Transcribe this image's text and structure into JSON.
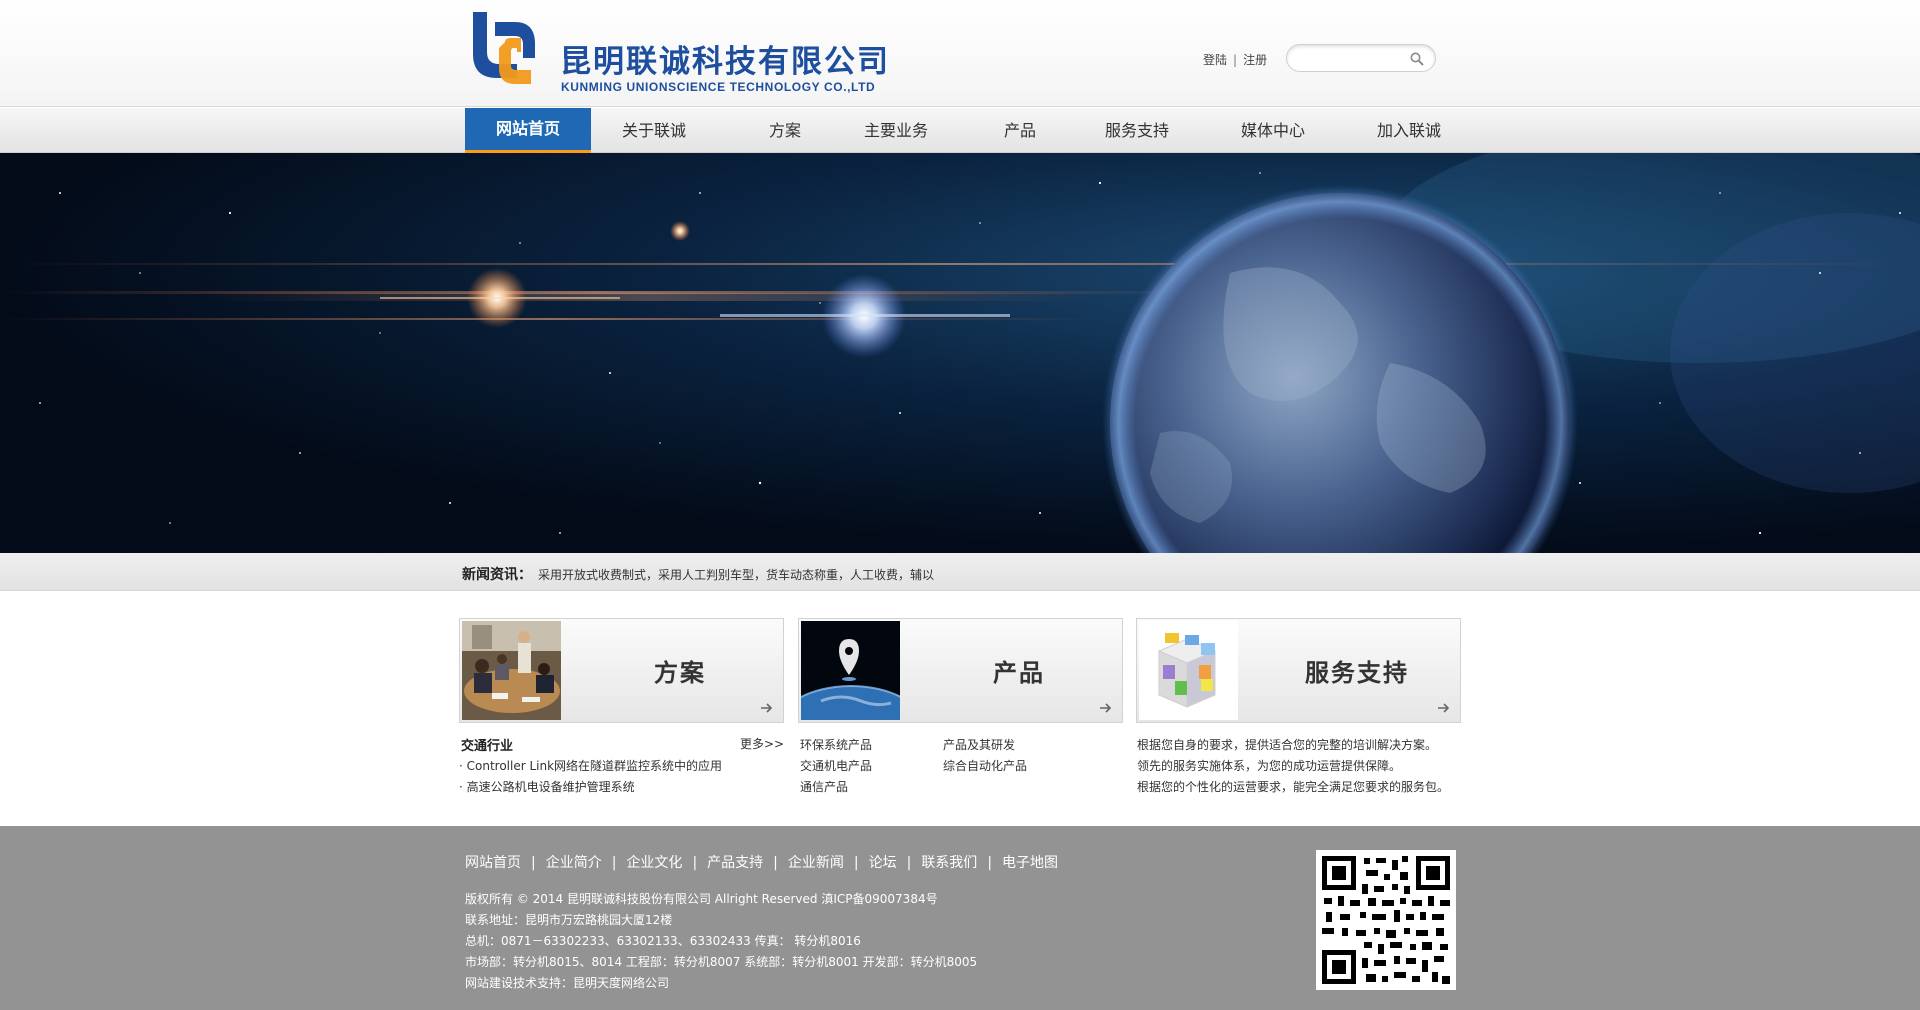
{
  "header": {
    "logo_cn": "昆明联诚科技有限公司",
    "logo_en": "KUNMING UNIONSCIENCE TECHNOLOGY CO.,LTD",
    "login": "登陆",
    "register": "注册",
    "search_placeholder": "",
    "search_icon": "magnifier-icon"
  },
  "nav": {
    "items": [
      "网站首页",
      "关于联诚",
      "方案",
      "主要业务",
      "产品",
      "服务支持",
      "媒体中心",
      "加入联诚"
    ],
    "active_index": 0
  },
  "news": {
    "label": "新闻资讯：",
    "text": "采用开放式收费制式，采用人工判别车型，货车动态称重，人工收费，辅以"
  },
  "cards": [
    {
      "title": "方案",
      "icon": "arrow-right-icon"
    },
    {
      "title": "产品",
      "icon": "arrow-right-icon"
    },
    {
      "title": "服务支持",
      "icon": "arrow-right-icon"
    }
  ],
  "solutions": {
    "heading": "交通行业",
    "more": "更多>>",
    "items": [
      "· Controller Link网络在隧道群监控系统中的应用",
      "· 高速公路机电设备维护管理系统"
    ]
  },
  "products": {
    "items": [
      "环保系统产品",
      "产品及其研发",
      "交通机电产品",
      "综合自动化产品",
      "通信产品"
    ]
  },
  "service": {
    "lines": [
      "根据您自身的要求，提供适合您的完整的培训解决方案。",
      "领先的服务实施体系，为您的成功运营提供保障。",
      "根据您的个性化的运营要求，能完全满足您要求的服务包。"
    ]
  },
  "footer": {
    "links": [
      "网站首页",
      "企业简介",
      "企业文化",
      "产品支持",
      "企业新闻",
      "论坛",
      "联系我们",
      "电子地图"
    ],
    "copyright": "版权所有 © 2014 昆明联诚科技股份有限公司 Allright Reserved  滇ICP备09007384号",
    "address": "联系地址：昆明市万宏路桃园大厦12楼",
    "phone": "总机：0871－63302233、63302133、63302433    传真： 转分机8016",
    "departments": "市场部：转分机8015、8014  工程部：转分机8007  系统部：转分机8001  开发部：转分机8005",
    "support": "网站建设技术支持：昆明天度网络公司",
    "qr_icon": "qr-code-icon"
  },
  "colors": {
    "brand_blue": "#1f68b4",
    "accent_orange": "#ff9a1a",
    "footer_gray": "#939393"
  }
}
